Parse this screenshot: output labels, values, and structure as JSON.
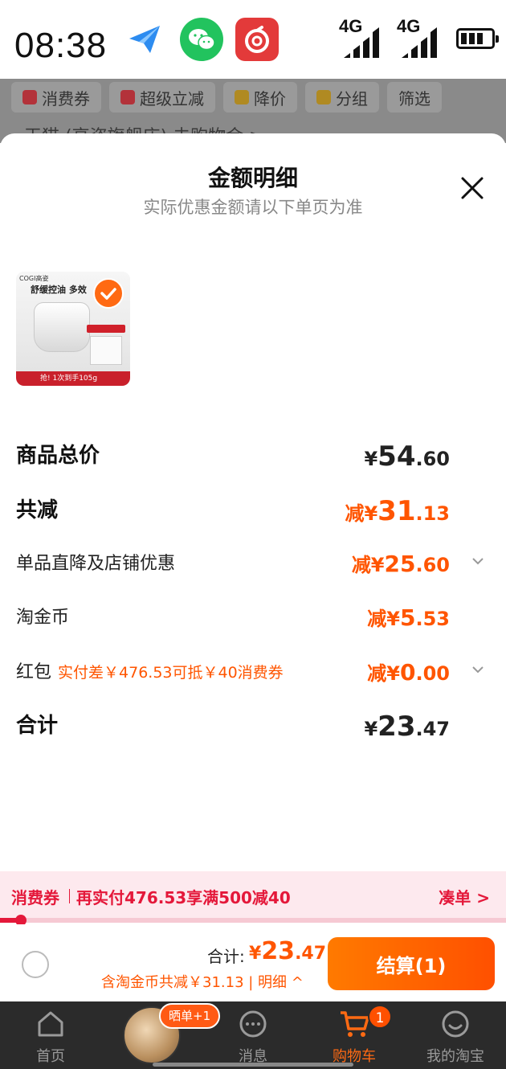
{
  "status": {
    "time": "08:38",
    "net1": "4G",
    "net2": "4G"
  },
  "background": {
    "chips": [
      "消费券",
      "超级立减",
      "降价",
      "分组",
      "筛选"
    ],
    "row_text": "天猫        (高姿旗舰店)               去购物金 >"
  },
  "sheet": {
    "title": "金额明细",
    "subtitle": "实际优惠金额请以下单页为准",
    "product": {
      "brand": "COGI高姿",
      "slogan": "舒缓控油 多效",
      "footer": "抢! 1次到手105g"
    },
    "rows": {
      "total": {
        "label": "商品总价",
        "currency": "¥",
        "int": "54",
        "dec": ".60"
      },
      "reduced": {
        "label": "共减",
        "prefix": "减¥",
        "int": "31",
        "dec": ".13"
      },
      "item_discount": {
        "label": "单品直降及店铺优惠",
        "prefix": "减¥",
        "int": "25",
        "dec": ".60"
      },
      "coins": {
        "label": "淘金币",
        "prefix": "减¥",
        "int": "5",
        "dec": ".53"
      },
      "redpack": {
        "label": "红包",
        "note": "实付差￥476.53可抵￥40消费券",
        "prefix": "减¥",
        "int": "0",
        "dec": ".00"
      },
      "sum": {
        "label": "合计",
        "currency": "¥",
        "int": "23",
        "dec": ".47"
      }
    }
  },
  "voucher_bar": {
    "tag": "消费券",
    "text": "再实付476.53享满500减40",
    "action": "凑单 >",
    "progress": 0.04
  },
  "checkout": {
    "sum_label": "合计:",
    "currency": "¥",
    "int": "23",
    "dec": ".47",
    "sub": "含淘金币共减￥31.13 | 明细 ^",
    "pay_label": "结算(1)"
  },
  "tabbar": {
    "items": [
      "首页",
      "",
      "消息",
      "购物车",
      "我的淘宝"
    ],
    "badge": "1",
    "pill": "晒单+1"
  },
  "colors": {
    "accent": "#ff5500",
    "voucher_red": "#e4183a"
  }
}
